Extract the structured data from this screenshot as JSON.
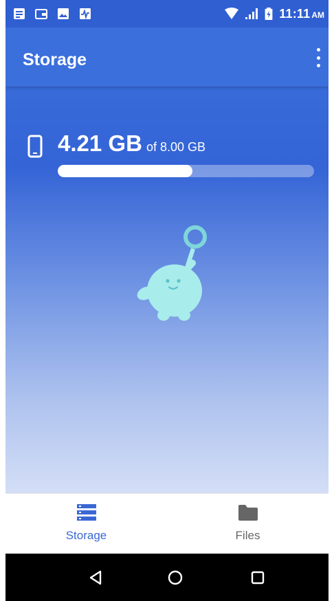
{
  "status_bar": {
    "time": "11:11",
    "ampm": "AM",
    "notification_icons": [
      "message-icon",
      "wallet-icon",
      "image-icon",
      "activity-icon"
    ],
    "system_icons": [
      "wifi-icon",
      "signal-icon",
      "battery-charging-icon"
    ]
  },
  "app_bar": {
    "title": "Storage",
    "menu_icon": "more-vert-icon"
  },
  "storage": {
    "used": "4.21 GB",
    "total_text": "of 8.00 GB",
    "used_fraction": 0.526,
    "device_icon": "phone-icon"
  },
  "illustration": "mascot-with-magnifier",
  "bottom_nav": {
    "items": [
      {
        "label": "Storage",
        "icon": "storage-list-icon",
        "active": true
      },
      {
        "label": "Files",
        "icon": "folder-icon",
        "active": false
      }
    ]
  },
  "system_nav": {
    "buttons": [
      "back-icon",
      "home-icon",
      "recent-apps-icon"
    ]
  },
  "colors": {
    "primary": "#3b6fdc",
    "status_bar": "#2f5fd1",
    "active_nav": "#3a67d4",
    "mascot": "#a9ecec",
    "mascot_outline": "#7fd6da"
  }
}
